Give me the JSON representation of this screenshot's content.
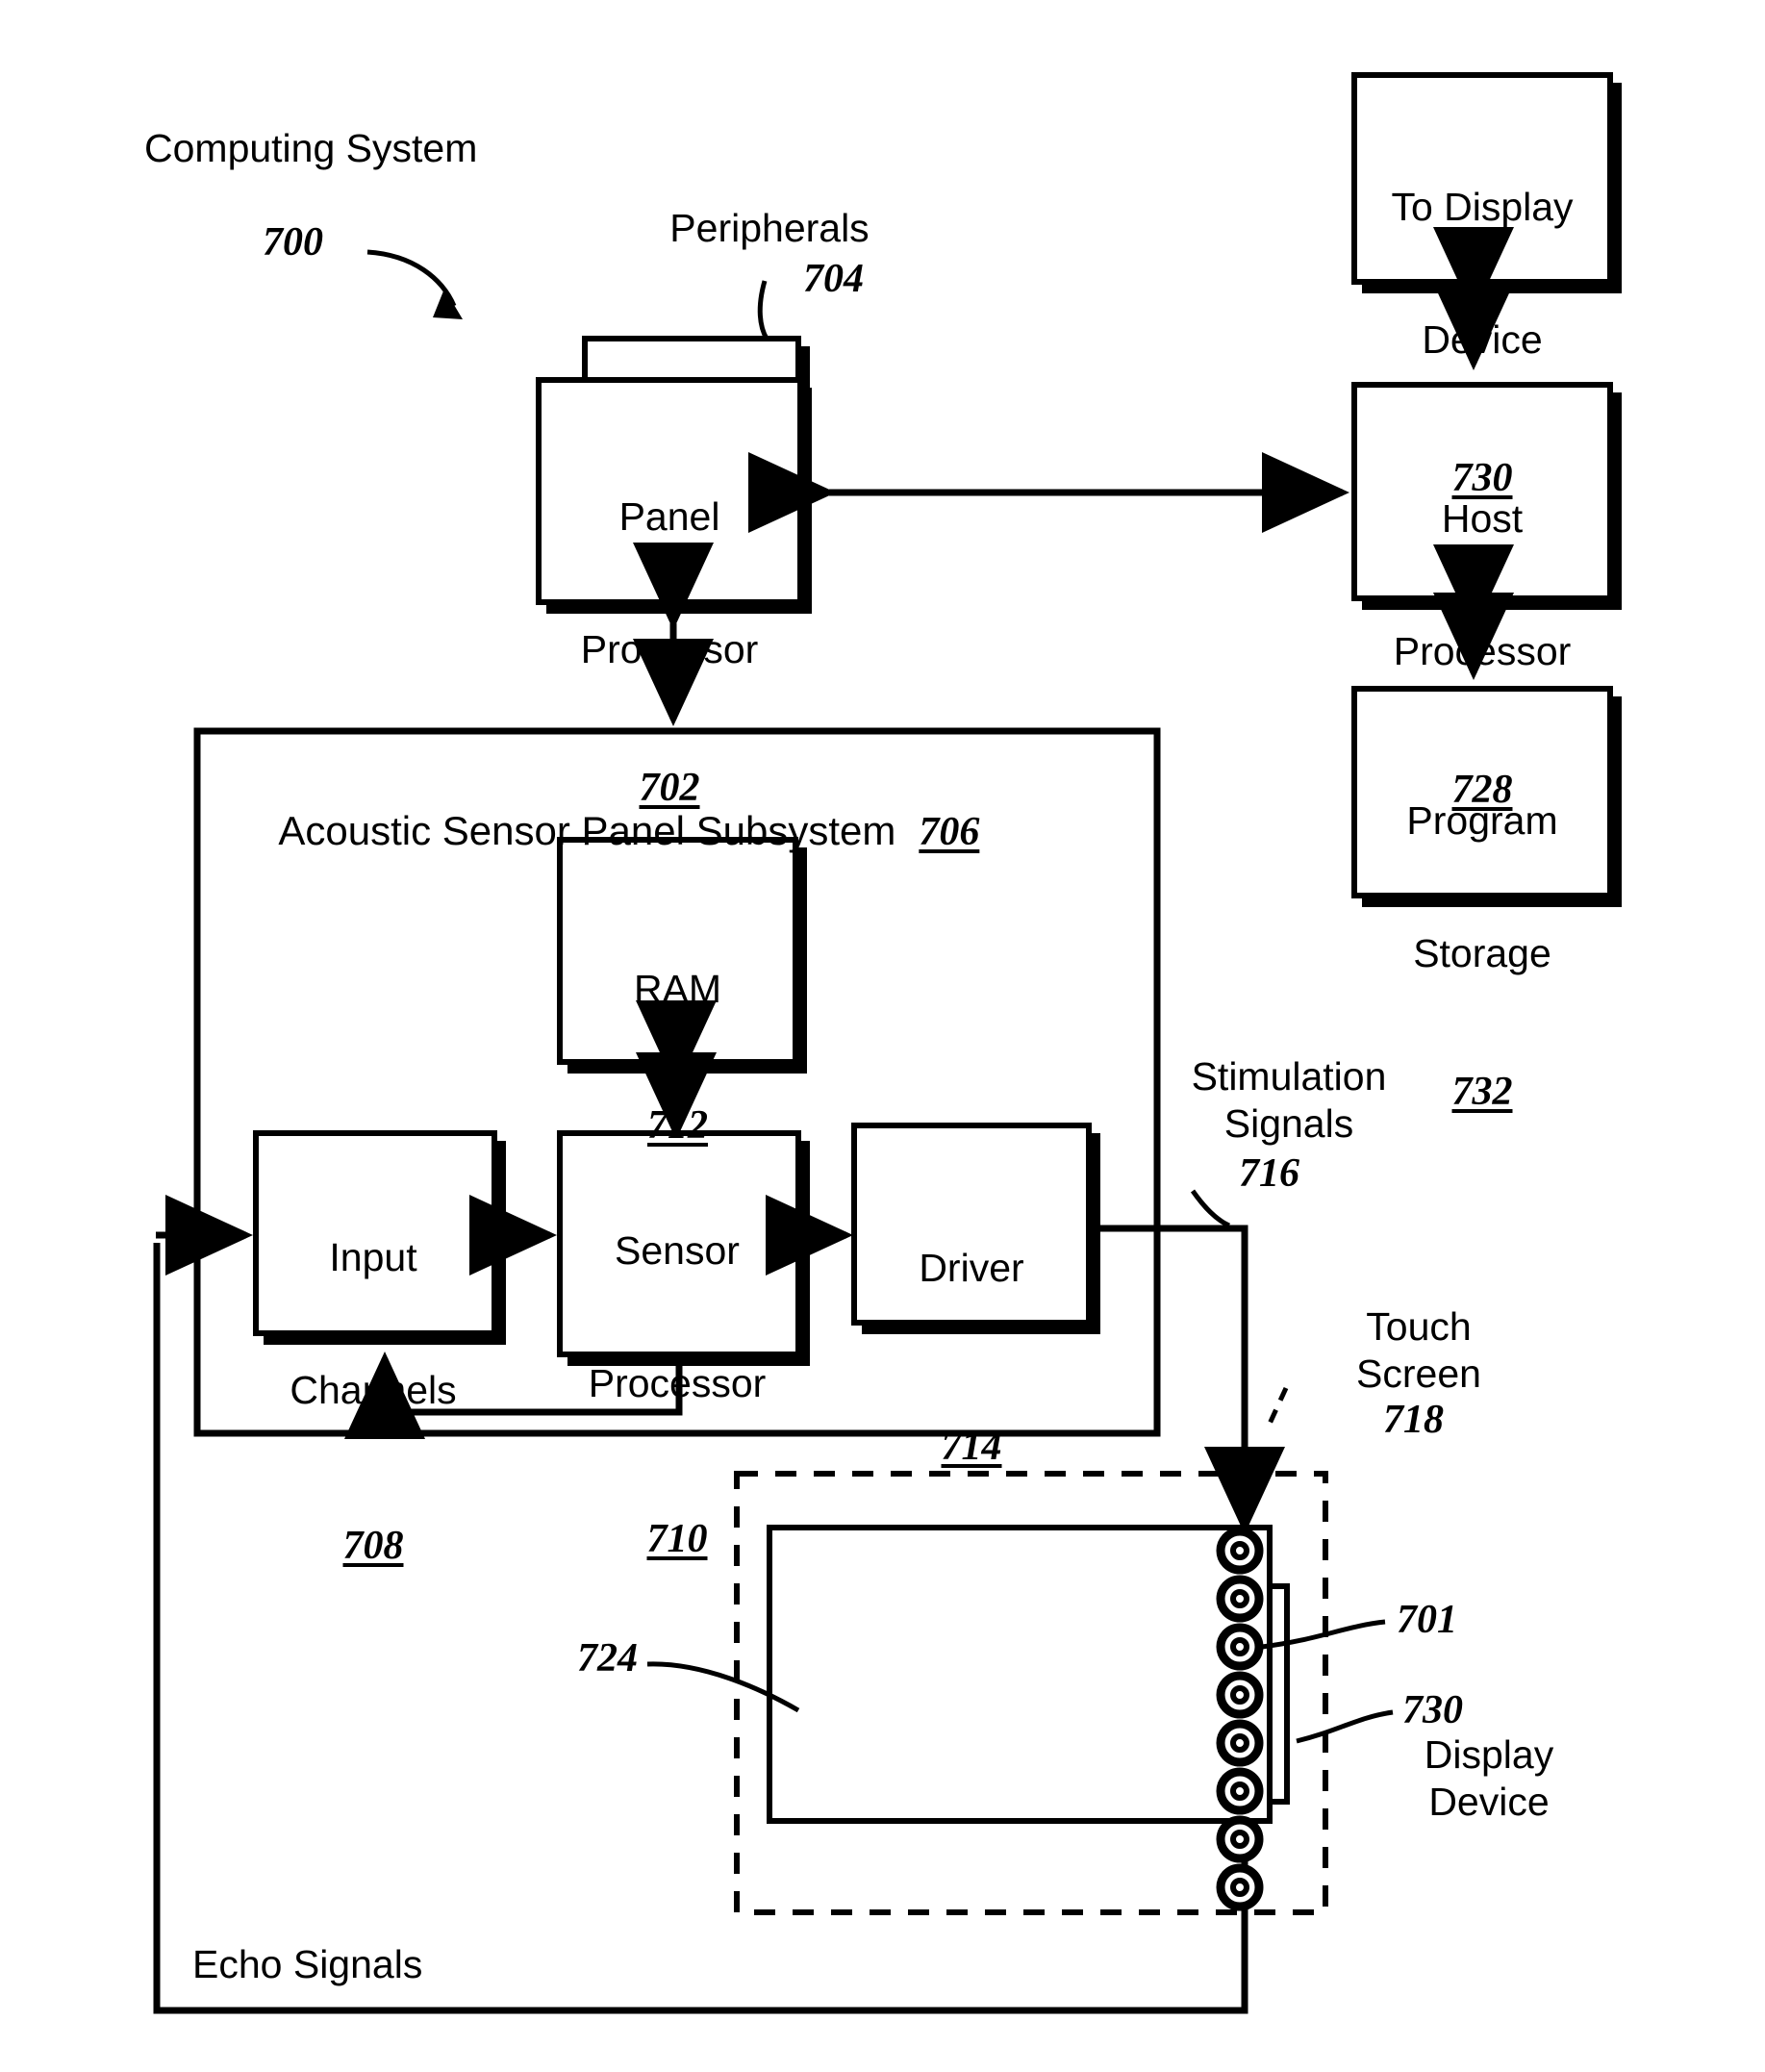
{
  "figure": {
    "title_label": "Computing System",
    "title_ref": "700"
  },
  "annotations": {
    "peripherals_label": "Peripherals",
    "peripherals_ref": "704",
    "stimulation_label": "Stimulation\nSignals",
    "stimulation_ref": "716",
    "touchscreen_label": "Touch\nScreen",
    "touchscreen_ref": "718",
    "echo_label": "Echo Signals",
    "transducer_ref": "701",
    "display_device_ref": "730",
    "display_device_label": "Display\nDevice",
    "panel_ref_724": "724"
  },
  "boxes": {
    "panel_processor": {
      "line1": "Panel",
      "line2": "Processor",
      "num": "702"
    },
    "host_processor": {
      "line1": "Host",
      "line2": "Processor",
      "num": "728"
    },
    "to_display_device": {
      "line1": "To Display",
      "line2": "Device",
      "num": "730"
    },
    "program_storage": {
      "line1": "Program",
      "line2": "Storage",
      "num": "732"
    },
    "ram": {
      "line1": "RAM",
      "num": "712"
    },
    "input_channels": {
      "line1": "Input",
      "line2": "Channels",
      "num": "708"
    },
    "sensor_processor": {
      "line1": "Sensor",
      "line2": "Processor",
      "num": "710"
    },
    "driver": {
      "line1": "Driver",
      "num": "714"
    }
  },
  "subsystem": {
    "title": "Acoustic Sensor Panel Subsystem",
    "num": "706"
  },
  "transducers": {
    "count": 8
  },
  "colors": {
    "stroke": "#000000",
    "background": "#ffffff"
  }
}
